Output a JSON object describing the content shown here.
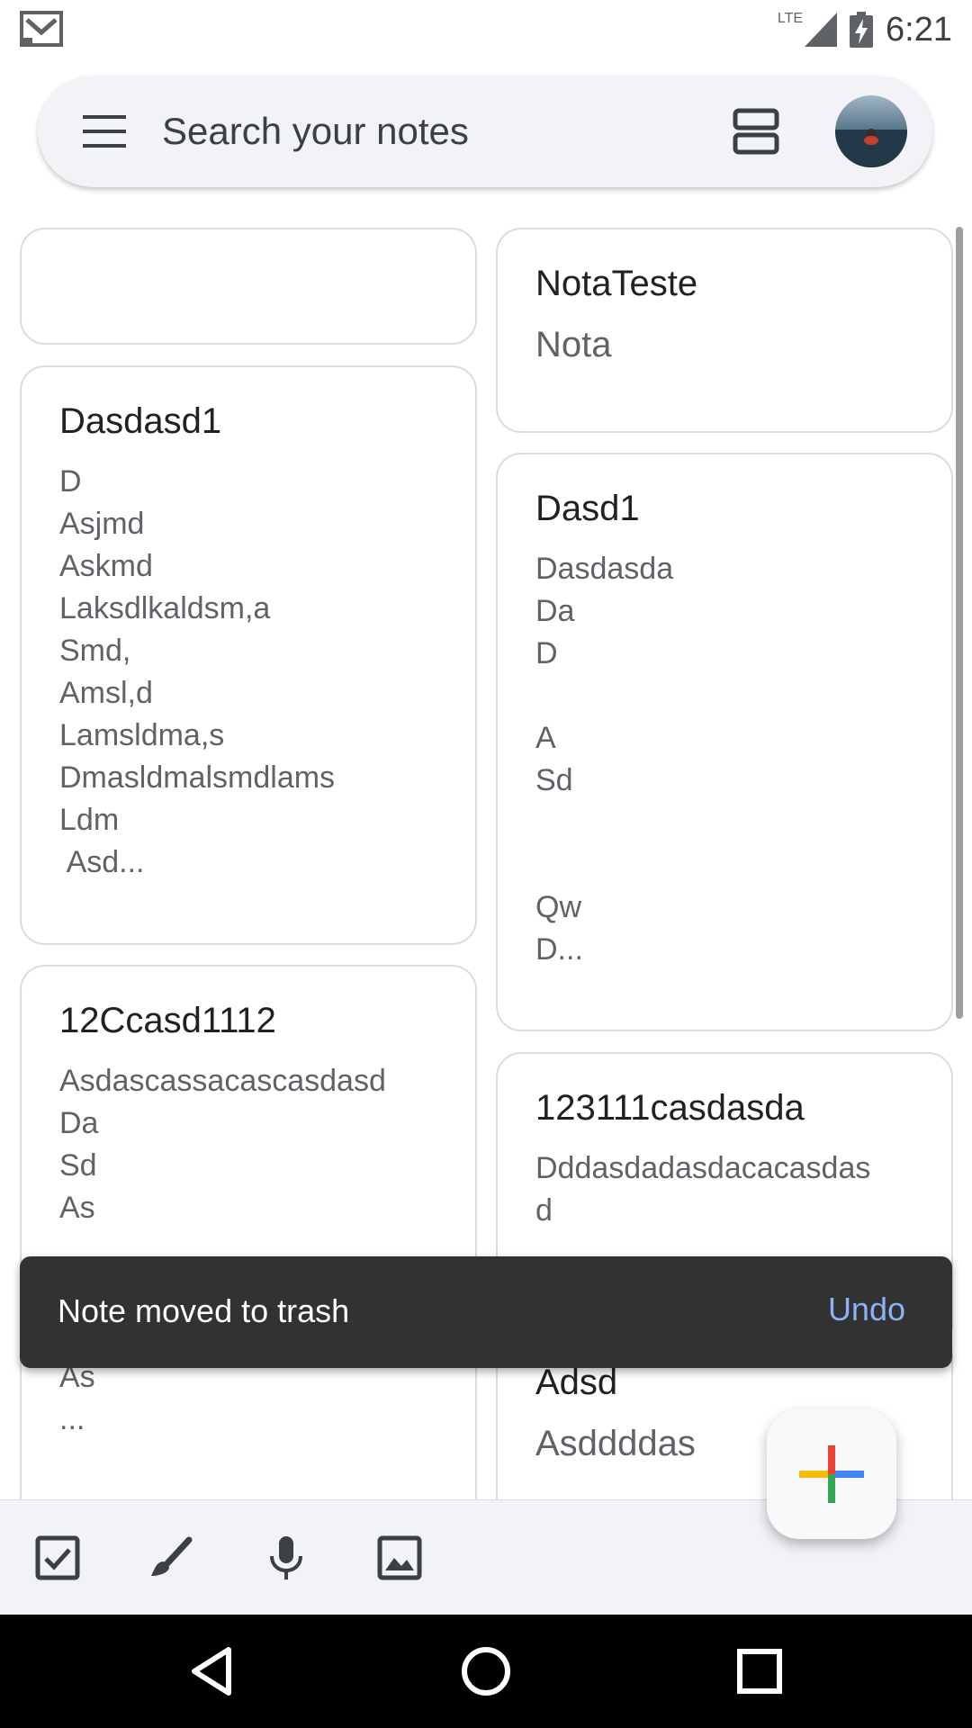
{
  "status_bar": {
    "time": "6:21",
    "network": "LTE"
  },
  "search": {
    "placeholder": "Search your notes"
  },
  "notes": {
    "left": [
      {
        "title": "",
        "body": ""
      },
      {
        "title": "Dasdasd1",
        "body": "D\nAsjmd\nAskmd\nLaksdlkaldsm,a\nSmd,\nAmsl,d\nLamsldma,s\nDmasldmalsmdlams\nLdm\n Asd..."
      },
      {
        "title": "12Ccasd1112",
        "body": "Asdascassacascasdasd\nDa\nSd\nAs\n\n\nD\nAs\n..."
      }
    ],
    "right": [
      {
        "title": "NotaTeste",
        "body": "Nota"
      },
      {
        "title": "Dasd1",
        "body": "Dasdasda\nDa\nD\n\nA\nSd\n\n\nQw\nD..."
      },
      {
        "title": "123111casdasda",
        "body": "Dddasdadasdacacasdas\nd"
      },
      {
        "title": "Adsd",
        "body": "Asddddas"
      }
    ]
  },
  "snackbar": {
    "message": "Note moved to trash",
    "action": "Undo"
  },
  "bottom_bar": {
    "icons": [
      "checkbox-icon",
      "brush-icon",
      "mic-icon",
      "image-icon"
    ]
  },
  "fab": {
    "icon": "plus-icon"
  },
  "nav": {
    "icons": [
      "back-icon",
      "home-icon",
      "recents-icon"
    ]
  }
}
